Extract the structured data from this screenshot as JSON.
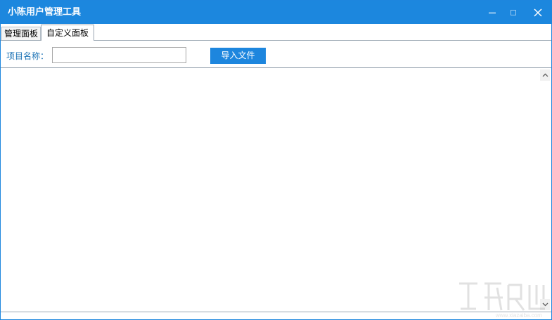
{
  "window": {
    "title": "小陈用户管理工具",
    "controls": [
      "minimize-icon",
      "maximize-icon",
      "close-icon"
    ],
    "accent_color": "#1c87de"
  },
  "tabs": [
    {
      "label": "管理面板",
      "active": false
    },
    {
      "label": "自定义面板",
      "active": true
    }
  ],
  "form": {
    "project_name_label": "项目名称：",
    "project_name_value": "",
    "import_button_label": "导入文件"
  },
  "content": {
    "scrollbar": {
      "up_icon": "chevron-up-icon",
      "down_icon": "chevron-down-icon"
    }
  },
  "watermark": {
    "icon": "download-site-watermark-logo"
  }
}
